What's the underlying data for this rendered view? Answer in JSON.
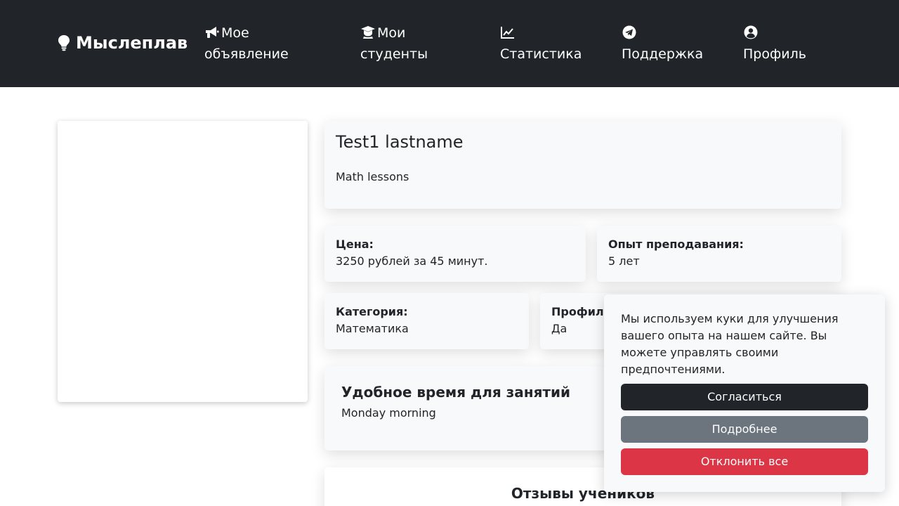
{
  "nav": {
    "brand": "Мыслеплав",
    "brand_icon": "lightbulb-icon",
    "links": [
      {
        "icon": "megaphone-icon",
        "line1": "Мое",
        "line2": "объявление"
      },
      {
        "icon": "graduate-icon",
        "line1": "Мои",
        "line2": "студенты"
      },
      {
        "icon": "chart-line-icon",
        "line1": "",
        "line2": "Статистика"
      },
      {
        "icon": "telegram-icon",
        "line1": "",
        "line2": "Поддержка"
      },
      {
        "icon": "user-circle-icon",
        "line1": "",
        "line2": "Профиль"
      }
    ],
    "bg_color": "#212529"
  },
  "tutor": {
    "name": "Test1 lastname",
    "description": "Math lessons"
  },
  "details": {
    "price_label": "Цена:",
    "price_value": "3250 рублей за 45 минут.",
    "experience_label": "Опыт преподавания:",
    "experience_value": "5 лет",
    "category_label": "Категория:",
    "category_value": "Математика",
    "profile_label": "Профил",
    "profile_value": "Да"
  },
  "schedule": {
    "title": "Удобное время для занятий",
    "value": "Monday morning"
  },
  "reviews": {
    "title": "Отзывы учеников"
  },
  "cookie_banner": {
    "text": "Мы используем куки для улучшения вашего опыта на нашем сайте. Вы можете управлять своими предпочтениями.",
    "accept_label": "Согласиться",
    "more_label": "Подробнее",
    "decline_label": "Отклонить все",
    "accept_color": "#212529",
    "more_color": "#6c757d",
    "decline_color": "#dc3545"
  }
}
